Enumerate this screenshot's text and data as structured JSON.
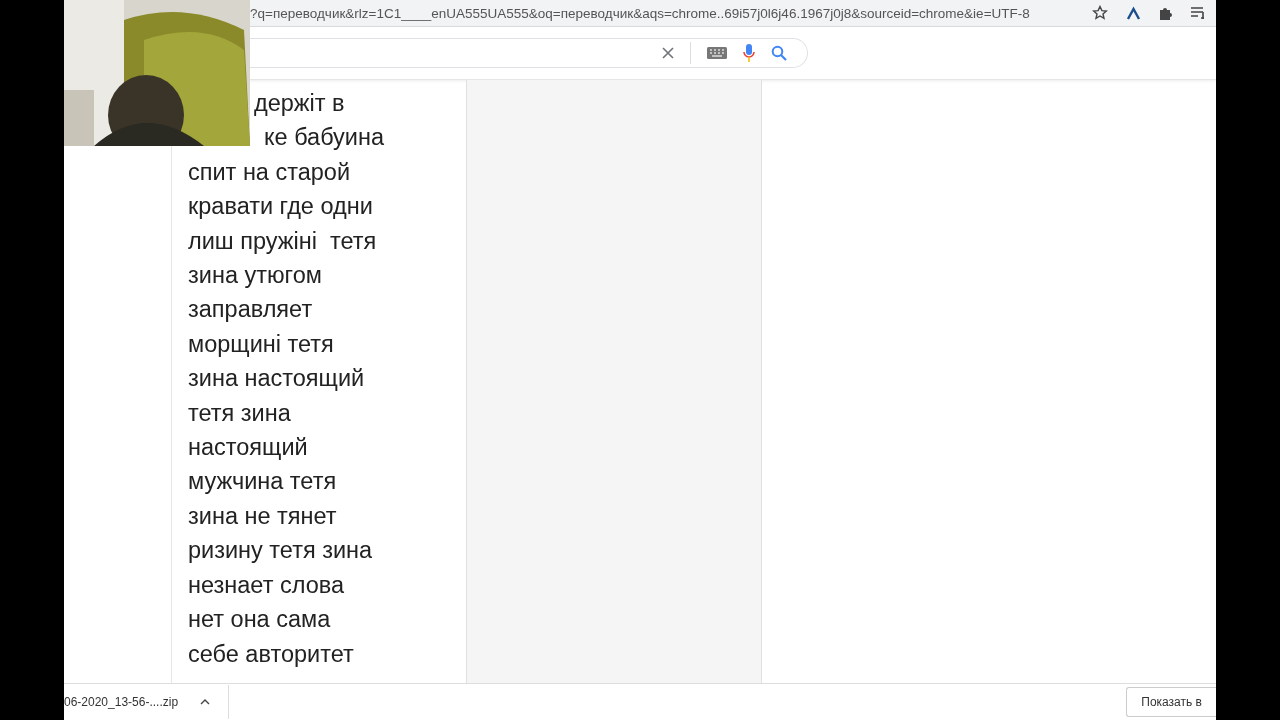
{
  "browser": {
    "url": "?q=переводчик&rlz=1C1____enUA555UA555&oq=переводчик&aqs=chrome..69i57j0l6j46.1967j0j8&sourceid=chrome&ie=UTF-8"
  },
  "translation_text": {
    "partly_hidden_lines": [
      "держіт в",
      "ке бабуина"
    ],
    "lines": [
      "спит на старой",
      "кравати где одни",
      "лиш пружіні  тетя",
      "зина утюгом",
      "заправляет",
      "морщині тетя",
      "зина настоящий",
      "тетя зина",
      "настоящий",
      "мужчина тетя",
      "зина не тянет",
      "ризину тетя зина",
      "незнает слова",
      "нет она сама",
      "себе авторитет"
    ]
  },
  "downloads": {
    "file": "06-2020_13-56-....zip",
    "show_all": "Показать в"
  }
}
